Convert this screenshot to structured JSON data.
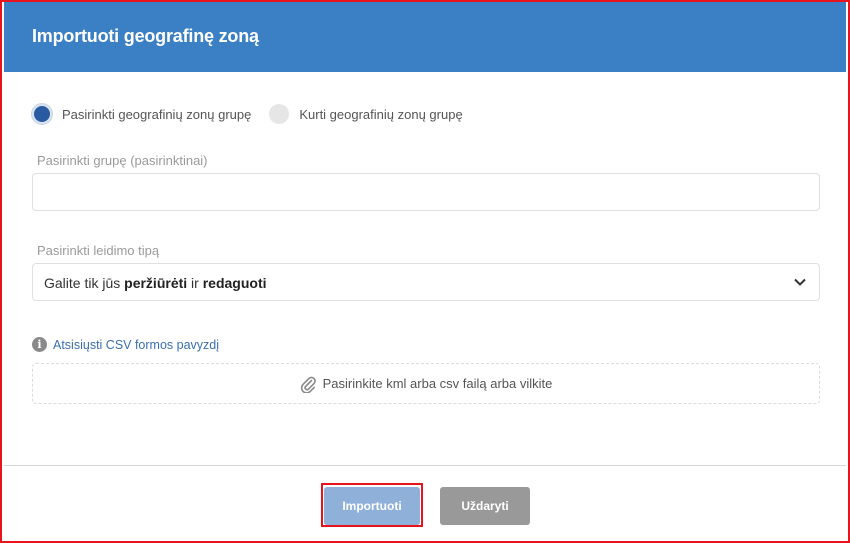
{
  "dialog": {
    "title": "Importuoti geografinę zoną"
  },
  "radios": [
    {
      "label": "Pasirinkti geografinių zonų grupę",
      "selected": true
    },
    {
      "label": "Kurti geografinių zonų grupę",
      "selected": false
    }
  ],
  "group_field": {
    "label": "Pasirinkti grupę (pasirinktinai)",
    "value": ""
  },
  "permission_field": {
    "label": "Pasirinkti leidimo tipą",
    "value_prefix": "Galite tik jūs",
    "value_bold1": "peržiūrėti",
    "value_mid": "ir",
    "value_bold2": "redaguoti"
  },
  "csv_link": "Atsisiųsti CSV formos pavyzdį",
  "dropzone": {
    "text": "Pasirinkite kml arba csv failą arba vilkite"
  },
  "buttons": {
    "import": "Importuoti",
    "close": "Uždaryti"
  },
  "colors": {
    "header": "#3b7fc4",
    "highlight_border": "#e8141d",
    "import_button": "#8fb0d9",
    "close_button": "#999999"
  }
}
